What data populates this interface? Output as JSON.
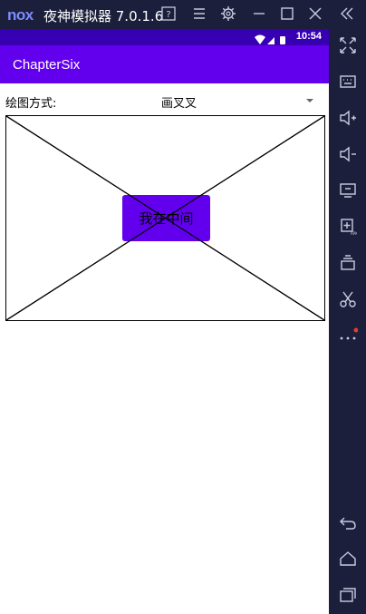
{
  "emulator": {
    "logo": "nox",
    "title": "夜神模拟器 7.0.1.6",
    "titlebar_icons": [
      "help-icon",
      "menu-icon",
      "settings-icon",
      "minimize-icon",
      "maximize-icon",
      "close-icon",
      "collapse-sidebar-icon"
    ],
    "sidebar_icons": [
      "fullscreen-icon",
      "keyboard-icon",
      "volume-up-icon",
      "volume-down-icon",
      "screen-icon",
      "install-apk-icon",
      "multi-instance-icon",
      "screenshot-scissors-icon",
      "more-icon",
      "back-icon",
      "home-icon",
      "recent-apps-icon"
    ],
    "more_badge_color": "#e53935"
  },
  "status_bar": {
    "time": "10:54",
    "color": "#3700b3"
  },
  "app_bar": {
    "title": "ChapterSix",
    "color": "#6200ee"
  },
  "drawing": {
    "label": "绘图方式:",
    "selected_mode": "画叉叉",
    "center_button": "我在中间",
    "button_color": "#6200ee"
  }
}
